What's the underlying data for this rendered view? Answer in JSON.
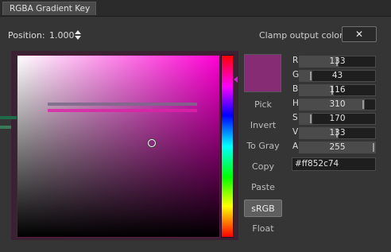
{
  "tab": {
    "label": "RGBA Gradient Key"
  },
  "position": {
    "label": "Position:",
    "value": "1.000"
  },
  "clamp": {
    "label": "Clamp output color",
    "button": "✕"
  },
  "swatch_color": "#852c74",
  "buttons": {
    "pick": "Pick",
    "invert": "Invert",
    "to_gray": "To Gray",
    "copy": "Copy",
    "paste": "Paste",
    "srgb": "sRGB",
    "float": "Float"
  },
  "channels": [
    {
      "label": "R",
      "value": "133",
      "fraction": 0.52
    },
    {
      "label": "G",
      "value": "43",
      "fraction": 0.17
    },
    {
      "label": "B",
      "value": "116",
      "fraction": 0.45
    },
    {
      "label": "H",
      "value": "310",
      "fraction": 0.86
    },
    {
      "label": "S",
      "value": "170",
      "fraction": 0.17
    },
    {
      "label": "V",
      "value": "133",
      "fraction": 0.52
    },
    {
      "label": "A",
      "value": "255",
      "fraction": 1.0
    }
  ],
  "hex": "#ff852c74"
}
